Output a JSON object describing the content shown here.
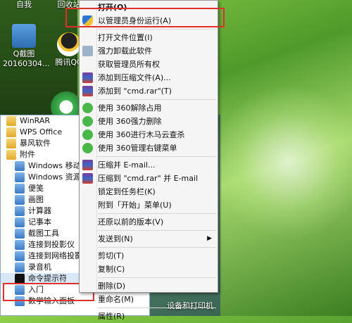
{
  "desktop": {
    "icons": [
      {
        "label_top": "Q截图",
        "label_bottom": "20160304..."
      },
      {
        "label_top": "腾讯QQ",
        "label_bottom": ""
      },
      {
        "label_top": "回收站",
        "label_bottom": ""
      },
      {
        "label_top": "自我",
        "label_bottom": ""
      }
    ]
  },
  "start_menu": {
    "items": [
      {
        "label": "WinRAR",
        "type": "folder"
      },
      {
        "label": "WPS Office",
        "type": "folder"
      },
      {
        "label": "暴风软件",
        "type": "folder"
      },
      {
        "label": "附件",
        "type": "folder"
      },
      {
        "label": "Windows 移动",
        "type": "app"
      },
      {
        "label": "Windows 资源",
        "type": "app"
      },
      {
        "label": "便笺",
        "type": "app"
      },
      {
        "label": "画图",
        "type": "app"
      },
      {
        "label": "计算器",
        "type": "app"
      },
      {
        "label": "记事本",
        "type": "app"
      },
      {
        "label": "截图工具",
        "type": "app"
      },
      {
        "label": "连接到投影仪",
        "type": "app"
      },
      {
        "label": "连接到网络投影",
        "type": "app"
      },
      {
        "label": "录音机",
        "type": "app"
      },
      {
        "label": "命令提示符",
        "type": "app"
      },
      {
        "label": "入门",
        "type": "app"
      },
      {
        "label": "数学输入面板",
        "type": "app"
      }
    ],
    "right_label": "设备和打印机"
  },
  "context_menu": {
    "items": [
      {
        "label": "打开(O)",
        "bold": true,
        "icon": ""
      },
      {
        "label": "以管理员身份运行(A)",
        "icon": "shield-icon"
      },
      {
        "sep": true
      },
      {
        "label": "打开文件位置(I)",
        "icon": ""
      },
      {
        "label": "强力卸载此软件",
        "icon": "trash-icon"
      },
      {
        "label": "获取管理员所有权",
        "icon": ""
      },
      {
        "label": "添加到压缩文件(A)...",
        "icon": "winrar-icon"
      },
      {
        "label": "添加到 \"cmd.rar\"(T)",
        "icon": "winrar-icon"
      },
      {
        "sep": true
      },
      {
        "label": "使用 360解除占用",
        "icon": "360-icon"
      },
      {
        "label": "使用 360强力删除",
        "icon": "360-icon"
      },
      {
        "label": "使用 360进行木马云查杀",
        "icon": "360-icon"
      },
      {
        "label": "使用 360管理右键菜单",
        "icon": "360-icon"
      },
      {
        "sep": true
      },
      {
        "label": "压缩并 E-mail...",
        "icon": "winrar-icon"
      },
      {
        "label": "压缩到 \"cmd.rar\" 并 E-mail",
        "icon": "winrar-icon"
      },
      {
        "label": "锁定到任务栏(K)",
        "icon": ""
      },
      {
        "label": "附到「开始」菜单(U)",
        "icon": ""
      },
      {
        "sep": true
      },
      {
        "label": "还原以前的版本(V)",
        "icon": ""
      },
      {
        "sep": true
      },
      {
        "label": "发送到(N)",
        "icon": "",
        "submenu": true
      },
      {
        "sep": true
      },
      {
        "label": "剪切(T)",
        "icon": ""
      },
      {
        "label": "复制(C)",
        "icon": ""
      },
      {
        "sep": true
      },
      {
        "label": "删除(D)",
        "icon": ""
      },
      {
        "label": "重命名(M)",
        "icon": ""
      },
      {
        "sep": true
      },
      {
        "label": "属性(R)",
        "icon": ""
      }
    ]
  },
  "colors": {
    "highlight_box": "#e0302b",
    "menu_bg": "#f5f5f5"
  }
}
